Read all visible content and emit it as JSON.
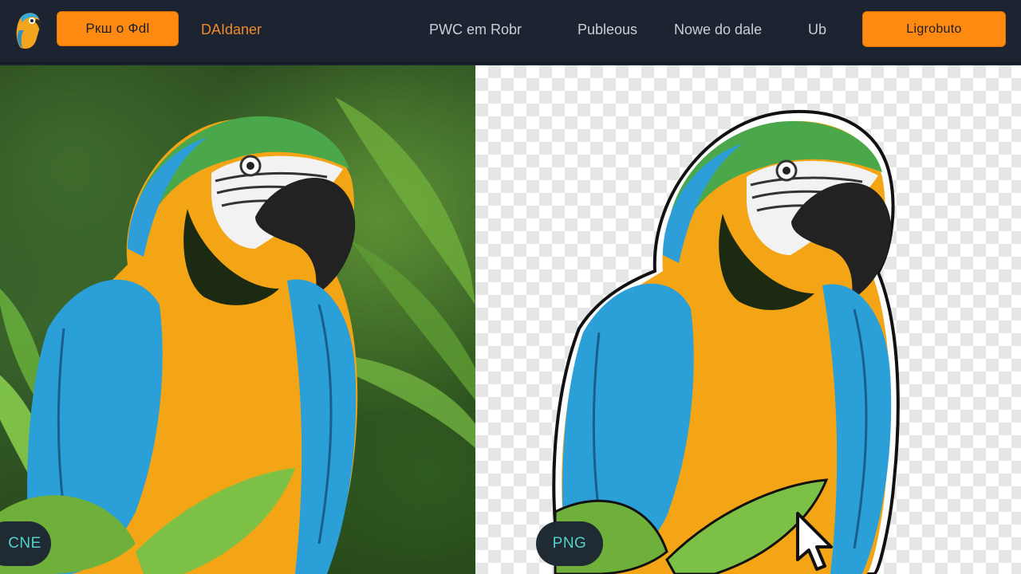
{
  "header": {
    "left_button_label": "Ркш о Фdl",
    "brand_link": "DAIdaner",
    "nav": [
      "PWC em Robr",
      "Publeous",
      "Nowe do dale",
      "Ub"
    ],
    "right_button_label": "Ligrobuto",
    "accent_color": "#ff8a12"
  },
  "panels": {
    "original_badge": "CNE",
    "result_badge": "PNG"
  },
  "icons": {
    "logo": "parrot-logo-icon",
    "cursor": "mouse-pointer-icon"
  }
}
